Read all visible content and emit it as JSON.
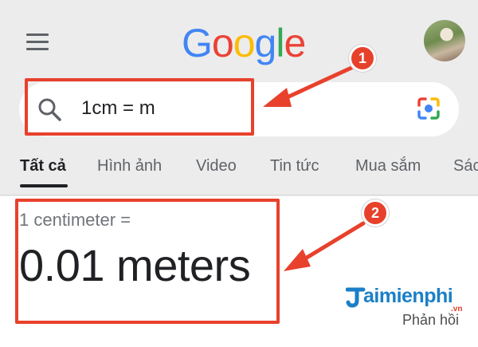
{
  "header": {
    "logo": {
      "letters": [
        "G",
        "o",
        "o",
        "g",
        "l",
        "e"
      ],
      "colors": [
        "#4285F4",
        "#EA4335",
        "#FBBC05",
        "#4285F4",
        "#34A853",
        "#EA4335"
      ]
    },
    "menu_icon": "hamburger-menu-icon",
    "avatar_icon": "profile-avatar"
  },
  "search": {
    "query": "1cm = m",
    "search_icon": "search-icon",
    "camera_icon": "google-lens-icon"
  },
  "tabs": [
    {
      "label": "Tất cả",
      "active": true
    },
    {
      "label": "Hình ảnh",
      "active": false
    },
    {
      "label": "Video",
      "active": false
    },
    {
      "label": "Tin tức",
      "active": false
    },
    {
      "label": "Mua sắm",
      "active": false
    },
    {
      "label": "Sác",
      "active": false
    }
  ],
  "result": {
    "label": "1 centimeter =",
    "value": "0.01 meters",
    "feedback": "Phản hồi"
  },
  "watermark": {
    "text": "aimienphi",
    "suffix": ".vn"
  },
  "annotations": {
    "badge1": "1",
    "badge2": "2",
    "color": "#e8412c"
  }
}
